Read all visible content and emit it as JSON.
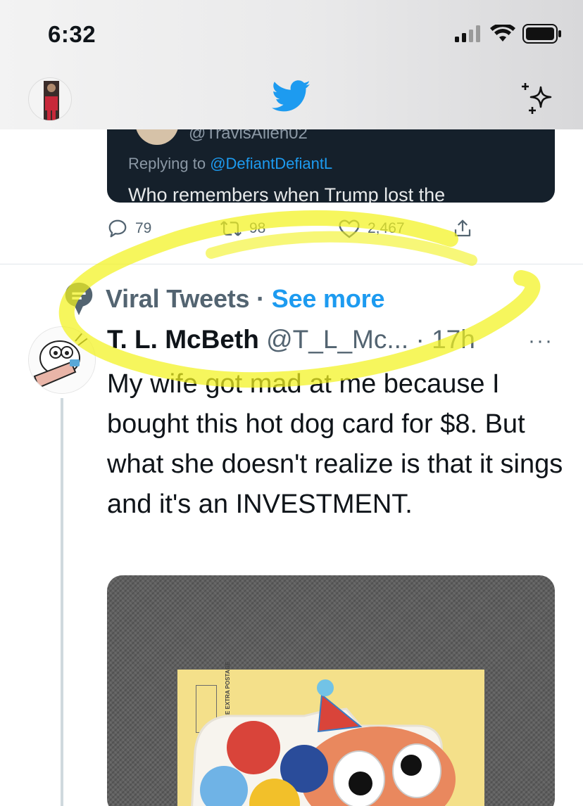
{
  "status_bar": {
    "time": "6:32"
  },
  "nav": {
    "logo_icon": "twitter-bird-icon",
    "sparkle_icon": "sparkle-icon"
  },
  "quoted_tweet": {
    "handle": "@TravisAllen02",
    "replying_prefix": "Replying to ",
    "replying_to": "@DefiantDefiantL",
    "text": "Who remembers when Trump lost the"
  },
  "actions": {
    "replies": "79",
    "retweets": "98",
    "likes": "2,467"
  },
  "social_context": {
    "topic": "Viral Tweets",
    "separator": " · ",
    "link": "See more"
  },
  "tweet": {
    "name": "T. L. McBeth",
    "handle": "@T_L_Mc...",
    "time": "· 17h",
    "more": "···",
    "text": "My wife got mad at me because I bought this hot dog card for $8. But what she doesn't realize is that it sings and it's an INVESTMENT."
  },
  "media": {
    "postage_text": "MAY REQUIRE EXTRA POSTAGE"
  },
  "colors": {
    "accent": "#1d9bf0",
    "secondary_text": "#536471",
    "highlighter": "#f2f21e"
  }
}
